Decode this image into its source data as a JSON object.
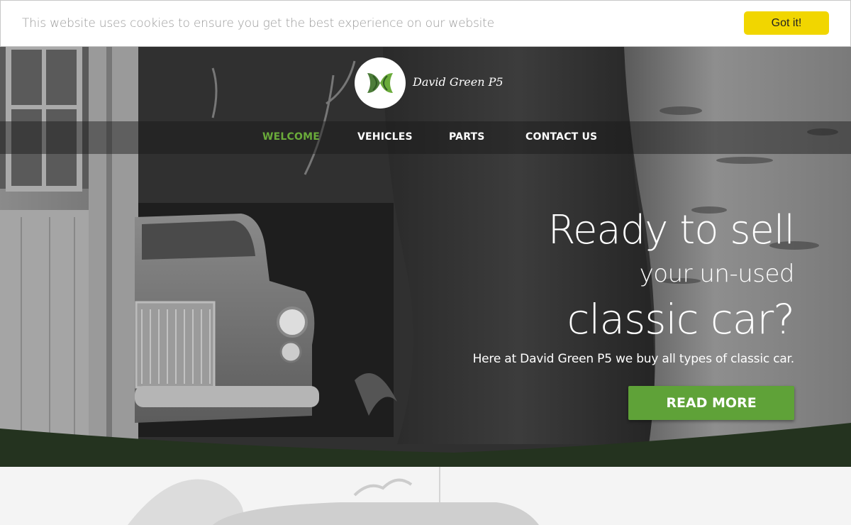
{
  "cookie": {
    "message": "This website uses cookies to ensure you get the best experience on our website",
    "button_label": "Got it!",
    "button_color": "#f1d600"
  },
  "brand": {
    "name": "David Green P5",
    "logo_icon": "dg-monogram-icon"
  },
  "nav": {
    "items": [
      {
        "label": "WELCOME",
        "active": true
      },
      {
        "label": "VEHICLES",
        "active": false
      },
      {
        "label": "PARTS",
        "active": false
      },
      {
        "label": "CONTACT US",
        "active": false
      }
    ],
    "active_color": "#6aab3a"
  },
  "hero": {
    "line1": "Ready to sell",
    "line2": "your un-used",
    "line3": "classic car?",
    "subtext": "Here at David Green P5 we buy all types of classic car.",
    "cta_label": "READ MORE",
    "cta_color": "#5fa238",
    "footer_band_color": "#24331f"
  }
}
